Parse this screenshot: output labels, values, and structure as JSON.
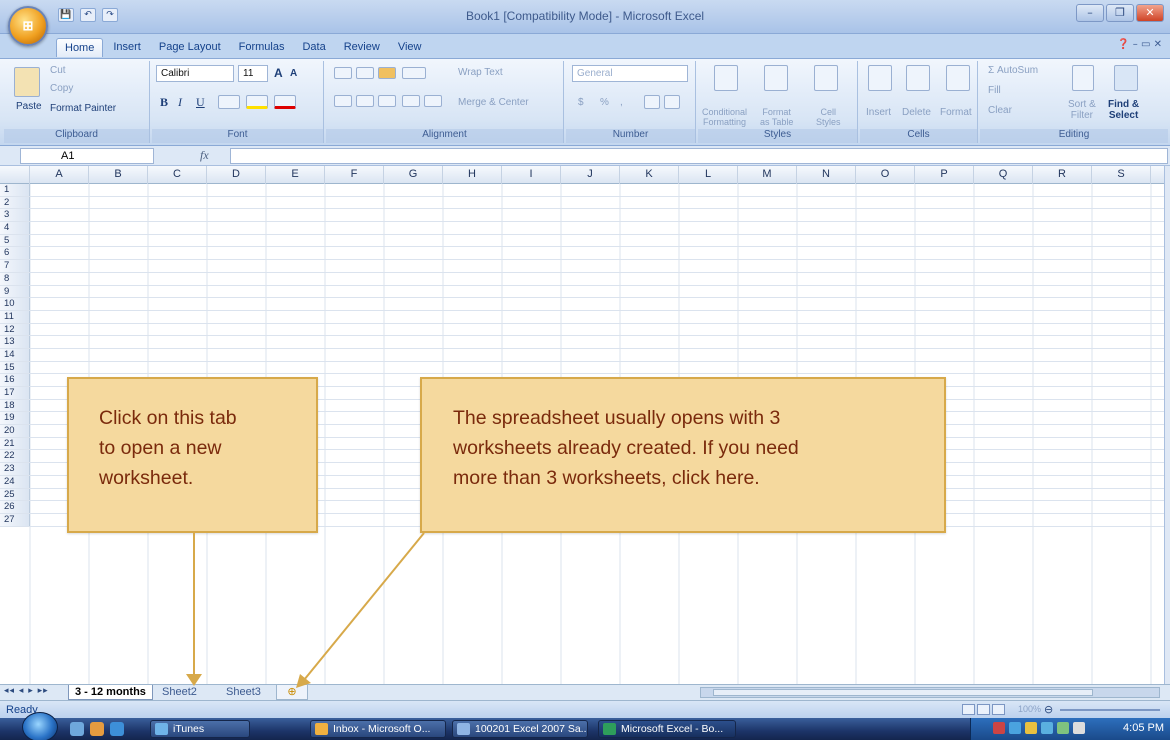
{
  "window": {
    "title": "Book1  [Compatibility Mode] - Microsoft Excel",
    "office_button": "⊞",
    "qat": [
      "💾",
      "↶",
      "↷"
    ],
    "controls": [
      "–",
      "❐",
      "✕"
    ]
  },
  "tabs": [
    "Home",
    "Insert",
    "Page Layout",
    "Formulas",
    "Data",
    "Review",
    "View"
  ],
  "tab_helpers": "❓ – ▭ ✕",
  "ribbon": {
    "clipboard": {
      "paste": "Paste",
      "cut": "Cut",
      "copy": "Copy",
      "format_painter": "Format Painter",
      "label": "Clipboard"
    },
    "font": {
      "name": "Calibri",
      "size": "11",
      "bold": "B",
      "italic": "I",
      "underline": "U",
      "grow": "A",
      "shrink": "A",
      "label": "Font"
    },
    "alignment": {
      "wrap": "Wrap Text",
      "merge": "Merge & Center",
      "label": "Alignment"
    },
    "number": {
      "format": "General",
      "currency": "$",
      "percent": "%",
      "comma": ",",
      "label": "Number"
    },
    "styles": {
      "conditional": "Conditional\nFormatting",
      "format_table": "Format\nas Table",
      "cell_styles": "Cell\nStyles",
      "label": "Styles"
    },
    "cells": {
      "insert": "Insert",
      "delete": "Delete",
      "format": "Format",
      "label": "Cells"
    },
    "editing": {
      "autosum": "Σ AutoSum",
      "fill": "Fill",
      "clear": "Clear",
      "sort": "Sort &\nFilter",
      "find": "Find &\nSelect",
      "label": "Editing"
    }
  },
  "formula_bar": {
    "name_box": "A1",
    "fx": "fx",
    "value": ""
  },
  "grid": {
    "columns": [
      "A",
      "B",
      "C",
      "D",
      "E",
      "F",
      "G",
      "H",
      "I",
      "J",
      "K",
      "L",
      "M",
      "N",
      "O",
      "P",
      "Q",
      "R",
      "S"
    ],
    "rows": [
      "1",
      "2",
      "3",
      "4",
      "5",
      "6",
      "7",
      "8",
      "9",
      "10",
      "11",
      "12",
      "13",
      "14",
      "15",
      "16",
      "17",
      "18",
      "19",
      "20",
      "21",
      "22",
      "23",
      "24",
      "25",
      "26",
      "27"
    ]
  },
  "sheets": {
    "nav": "◂◂ ◂ ▸ ▸▸",
    "active": "3 - 12 months",
    "others": [
      "Sheet2",
      "Sheet3"
    ],
    "new_sheet": "⊕"
  },
  "status": {
    "ready": "Ready",
    "zoom": "100%",
    "minus": "⊖"
  },
  "taskbar": {
    "items": [
      "iTunes",
      "Inbox - Microsoft O...",
      "100201 Excel 2007 Sa...",
      "Microsoft Excel - Bo..."
    ],
    "clock": "4:05 PM"
  },
  "callouts": {
    "tab_note": "Click on this tab\nto open a new\nworksheet.",
    "sheets_note": "The spreadsheet usually opens with 3\nworksheets already created. If you need\nmore than 3 worksheets, click here."
  },
  "colors": {
    "callout_fill": "#f5d99e",
    "callout_border": "#d7a94a",
    "callout_text": "#7a2a0c",
    "arrow": "#d7a94a"
  }
}
